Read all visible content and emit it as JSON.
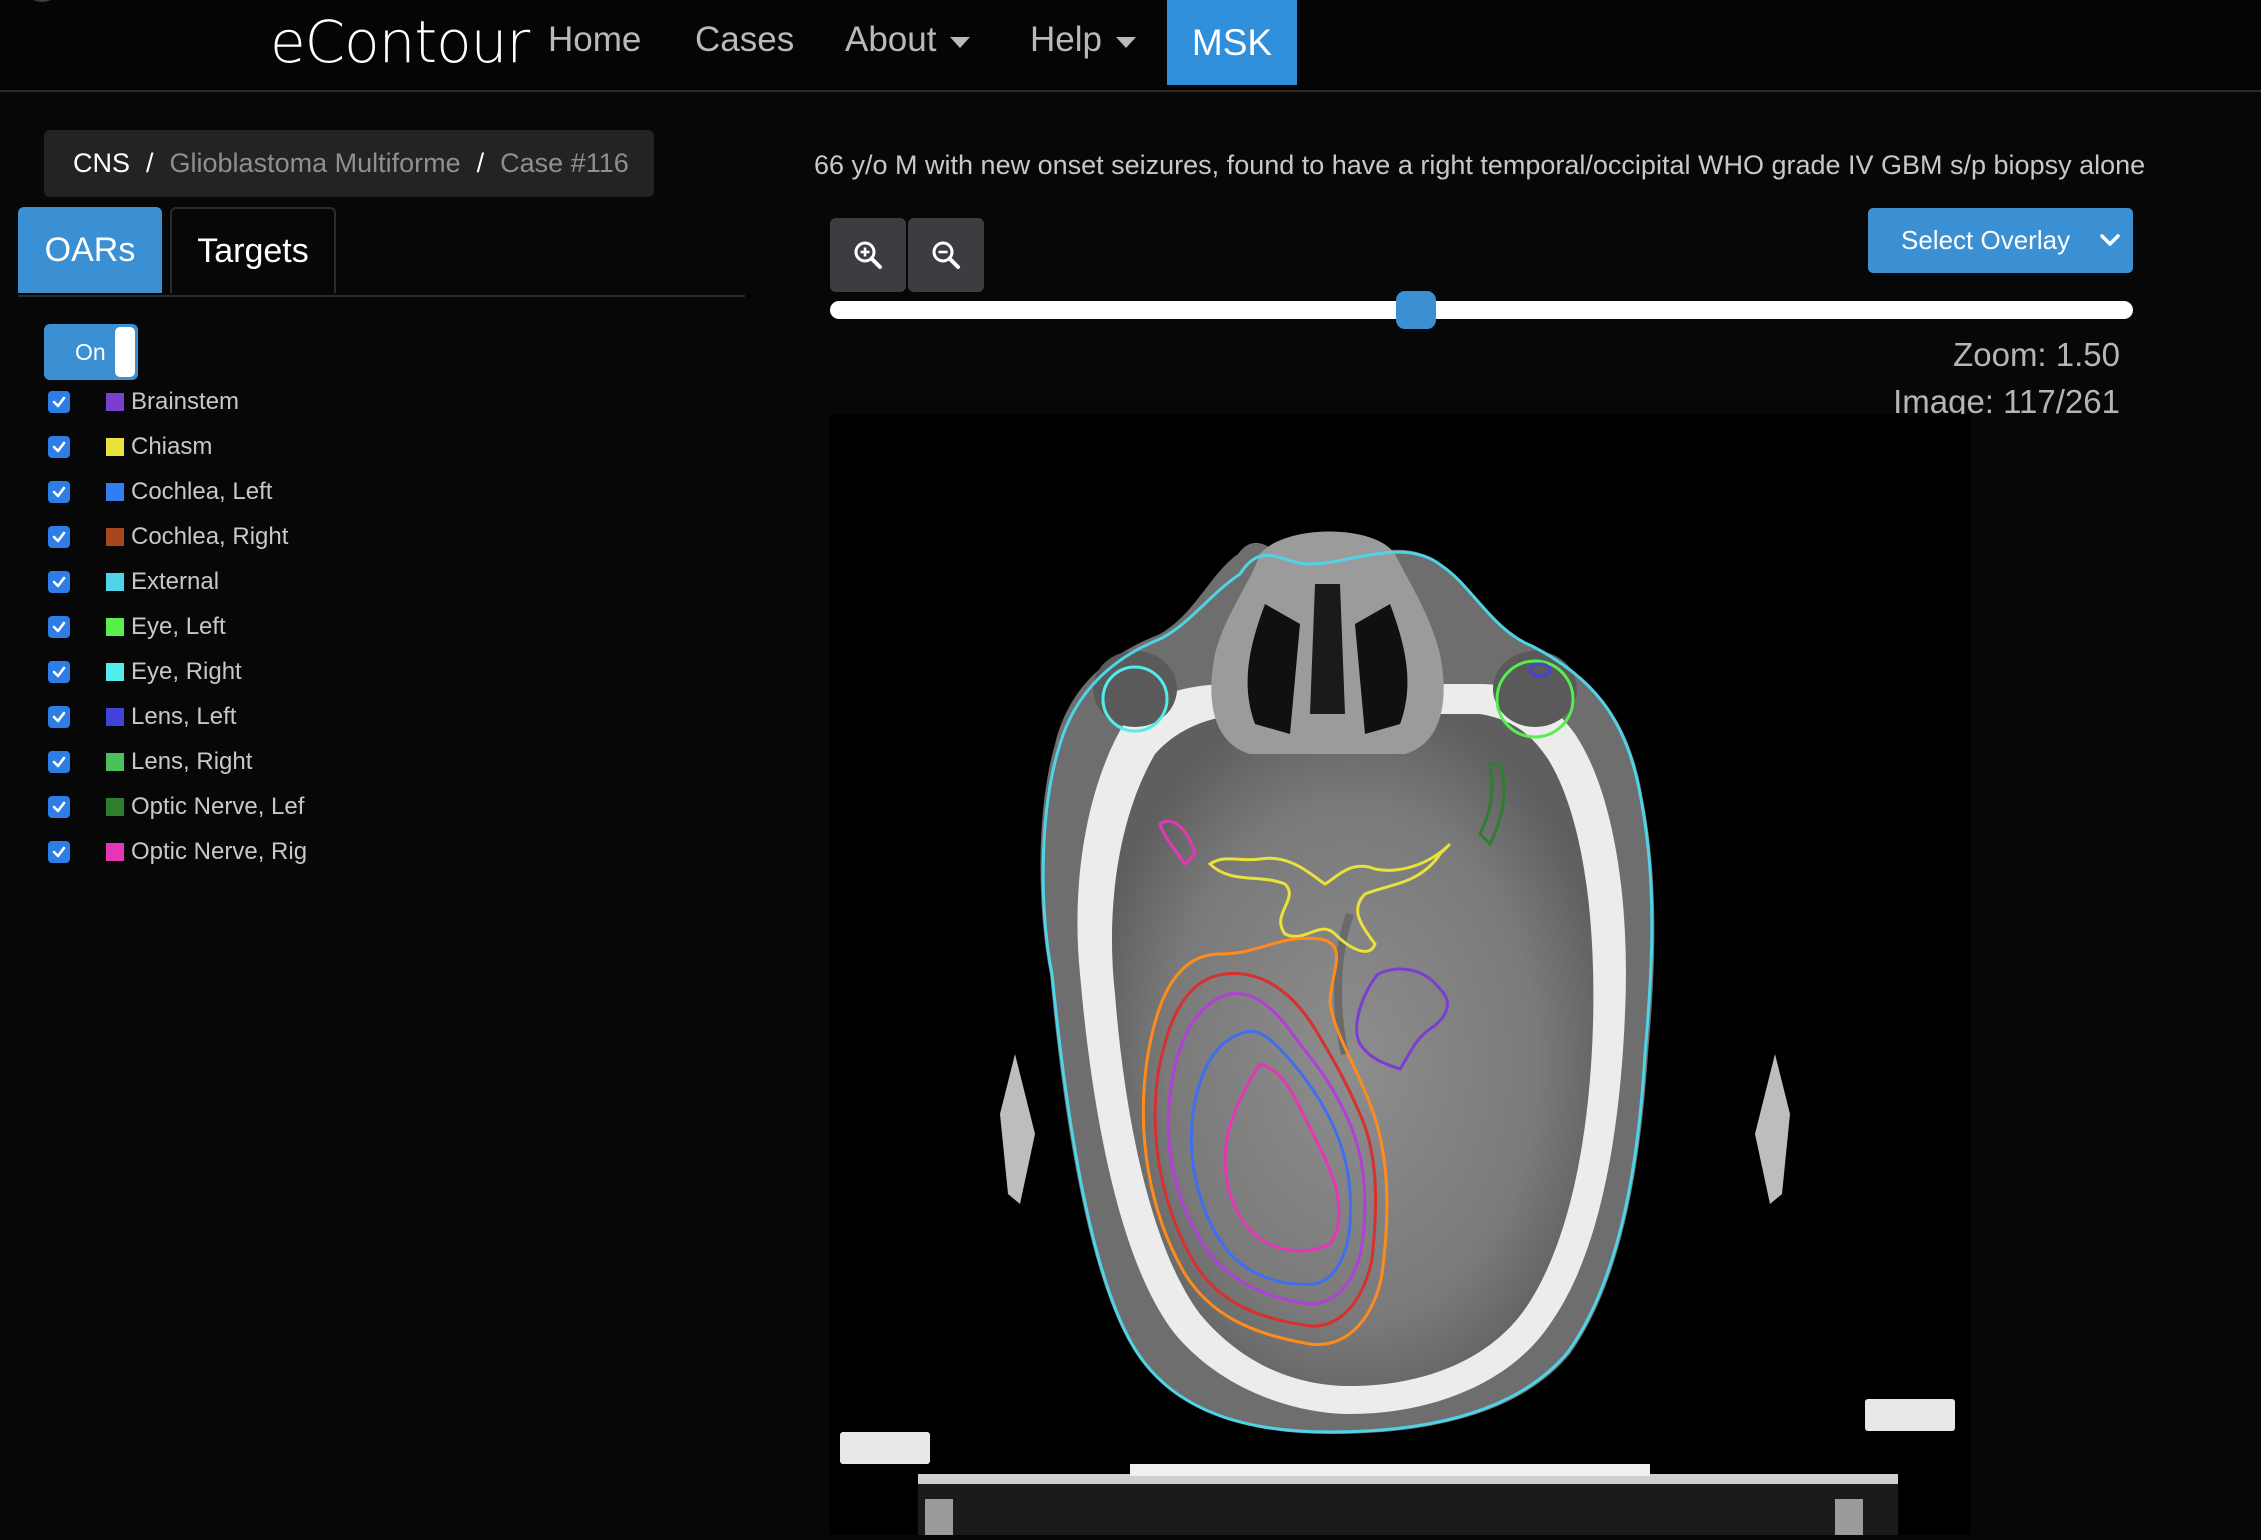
{
  "navbar": {
    "brand": "eContour",
    "links": {
      "home": "Home",
      "cases": "Cases",
      "about": "About",
      "help": "Help",
      "msk": "MSK"
    }
  },
  "breadcrumb": {
    "items": [
      "CNS",
      "Glioblastoma Multiforme",
      "Case #116"
    ],
    "separator": "/"
  },
  "tabs": {
    "oars": "OARs",
    "targets": "Targets"
  },
  "toggle": {
    "label": "On",
    "state": true
  },
  "oars": [
    {
      "label": "Brainstem",
      "color": "#7b3fd0",
      "checked": true
    },
    {
      "label": "Chiasm",
      "color": "#e8e23a",
      "checked": true
    },
    {
      "label": "Cochlea, Left",
      "color": "#2f7ff0",
      "checked": true
    },
    {
      "label": "Cochlea, Right",
      "color": "#a5461d",
      "checked": true
    },
    {
      "label": "External",
      "color": "#4fd3e6",
      "checked": true
    },
    {
      "label": "Eye, Left",
      "color": "#56ef4c",
      "checked": true
    },
    {
      "label": "Eye, Right",
      "color": "#52ecec",
      "checked": true
    },
    {
      "label": "Lens, Left",
      "color": "#4343d8",
      "checked": true
    },
    {
      "label": "Lens, Right",
      "color": "#4cc05c",
      "checked": true
    },
    {
      "label": "Optic Nerve, Lef",
      "color": "#2f7d2f",
      "checked": true
    },
    {
      "label": "Optic Nerve, Rig",
      "color": "#e636b8",
      "checked": true
    }
  ],
  "viewer": {
    "case_description": "66 y/o M with new onset seizures, found to have a right temporal/occipital WHO grade IV GBM s/p biopsy alone",
    "zoom_in_icon": "zoom-in-icon",
    "zoom_out_icon": "zoom-out-icon",
    "overlay_select": "Select Overlay",
    "slice_fraction": 0.45,
    "zoom_text": "Zoom: 1.50",
    "image_text": "Image: 117/261"
  },
  "colors": {
    "accent": "#3b8fd3",
    "background": "#070707"
  }
}
